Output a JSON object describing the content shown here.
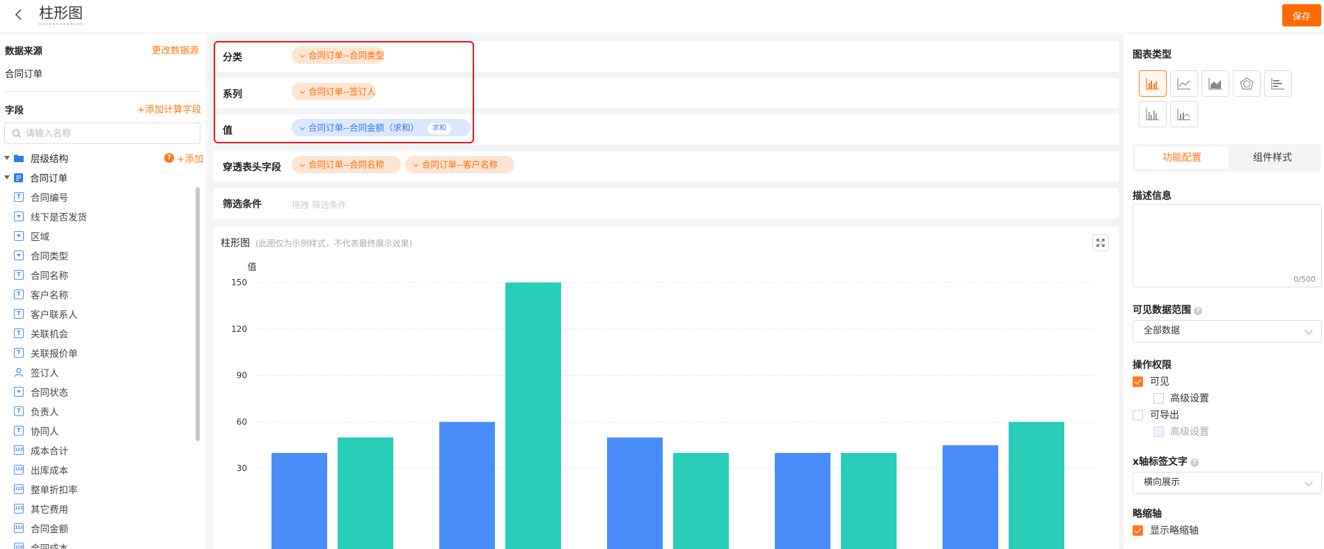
{
  "header": {
    "title": "柱形图",
    "save_label": "保存"
  },
  "left": {
    "datasource_label": "数据来源",
    "change_source_label": "更改数据源",
    "datasource_name": "合同订单",
    "fields_label": "字段",
    "add_calc_label": "+添加计算字段",
    "search_placeholder": "请输入名称",
    "hierarchy_label": "层级结构",
    "add_label": "+添加",
    "table_name": "合同订单",
    "fields": [
      {
        "name": "合同编号",
        "icon": "text-field-icon"
      },
      {
        "name": "线下是否发货",
        "icon": "select-field-icon"
      },
      {
        "name": "区域",
        "icon": "select-field-icon"
      },
      {
        "name": "合同类型",
        "icon": "select-field-icon"
      },
      {
        "name": "合同名称",
        "icon": "text-field-icon"
      },
      {
        "name": "客户名称",
        "icon": "text-field-icon"
      },
      {
        "name": "客户联系人",
        "icon": "text-field-icon"
      },
      {
        "name": "关联机会",
        "icon": "text-field-icon"
      },
      {
        "name": "关联报价单",
        "icon": "text-field-icon"
      },
      {
        "name": "签订人",
        "icon": "user-field-icon"
      },
      {
        "name": "合同状态",
        "icon": "select-field-icon"
      },
      {
        "name": "负责人",
        "icon": "text-field-icon"
      },
      {
        "name": "协同人",
        "icon": "text-field-icon"
      },
      {
        "name": "成本合计",
        "icon": "number-field-icon"
      },
      {
        "name": "出库成本",
        "icon": "number-field-icon"
      },
      {
        "name": "整单折扣率",
        "icon": "number-field-icon"
      },
      {
        "name": "其它费用",
        "icon": "number-field-icon"
      },
      {
        "name": "合同金额",
        "icon": "number-field-icon"
      },
      {
        "name": "合同成本",
        "icon": "number-field-icon"
      }
    ]
  },
  "config": {
    "category": {
      "label": "分类",
      "chips": [
        "合同订单--合同类型"
      ]
    },
    "series": {
      "label": "系列",
      "chips": [
        "合同订单--签订人"
      ]
    },
    "value": {
      "label": "值",
      "chip": "合同订单--合同金额（求和）",
      "badge": "求和"
    },
    "drill": {
      "label": "穿透表头字段",
      "chips": [
        "合同订单--合同名称",
        "合同订单--客户名称"
      ]
    },
    "filter": {
      "label": "筛选条件",
      "placeholder": "拖拽 筛选条件"
    }
  },
  "chart_panel": {
    "title": "柱形图",
    "subtitle": "(此图仅为示例样式，不代表最终展示效果)"
  },
  "chart_data": {
    "type": "bar",
    "categories": [
      "",
      "",
      "",
      "",
      ""
    ],
    "series": [
      {
        "values": [
          40,
          60,
          50,
          40,
          45
        ],
        "color": "#4a8df8"
      },
      {
        "values": [
          50,
          150,
          40,
          40,
          60
        ],
        "color": "#27cdb8"
      }
    ],
    "ylabel": "值",
    "yticks": [
      30,
      60,
      90,
      120,
      150
    ],
    "ylim": [
      0,
      150
    ],
    "grid": true
  },
  "right": {
    "chart_type_label": "图表类型",
    "chart_types": [
      "bar-chart-icon",
      "line-chart-icon",
      "area-chart-icon",
      "radar-chart-icon",
      "horizontal-bar-icon",
      "grouped-bar-icon",
      "bar-line-icon"
    ],
    "tab_function": "功能配置",
    "tab_style": "组件样式",
    "desc_label": "描述信息",
    "desc_counter": "0/500",
    "visible_range_label": "可见数据范围",
    "visible_range_value": "全部数据",
    "permission_label": "操作权限",
    "perm_visible": "可见",
    "perm_advanced": "高级设置",
    "perm_export": "可导出",
    "perm_export_advanced": "高级设置",
    "xaxis_label": "x轴标签文字",
    "xaxis_value": "横向展示",
    "thumb_axis_label": "略缩轴",
    "thumb_axis_check": "显示略缩轴",
    "accent": "#ff7a1a"
  }
}
